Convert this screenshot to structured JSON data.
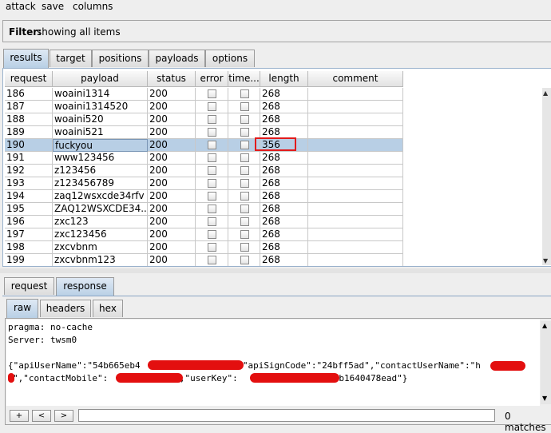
{
  "menu": [
    "attack",
    "save",
    "columns"
  ],
  "filter": {
    "label": "Filter:",
    "text": "showing all items"
  },
  "top_tabs": [
    "results",
    "target",
    "positions",
    "payloads",
    "options"
  ],
  "columns": [
    "request",
    "payload",
    "status",
    "error",
    "time...",
    "length",
    "comment"
  ],
  "rows": [
    {
      "request": "186",
      "payload": "woaini1314",
      "status": "200",
      "length": "268"
    },
    {
      "request": "187",
      "payload": "woaini1314520",
      "status": "200",
      "length": "268"
    },
    {
      "request": "188",
      "payload": "woaini520",
      "status": "200",
      "length": "268"
    },
    {
      "request": "189",
      "payload": "woaini521",
      "status": "200",
      "length": "268"
    },
    {
      "request": "190",
      "payload": "fuckyou",
      "status": "200",
      "length": "356"
    },
    {
      "request": "191",
      "payload": "www123456",
      "status": "200",
      "length": "268"
    },
    {
      "request": "192",
      "payload": "z123456",
      "status": "200",
      "length": "268"
    },
    {
      "request": "193",
      "payload": "z123456789",
      "status": "200",
      "length": "268"
    },
    {
      "request": "194",
      "payload": "zaq12wsxcde34rfv",
      "status": "200",
      "length": "268"
    },
    {
      "request": "195",
      "payload": "ZAQ12WSXCDE34...",
      "status": "200",
      "length": "268"
    },
    {
      "request": "196",
      "payload": "zxc123",
      "status": "200",
      "length": "268"
    },
    {
      "request": "197",
      "payload": "zxc123456",
      "status": "200",
      "length": "268"
    },
    {
      "request": "198",
      "payload": "zxcvbnm",
      "status": "200",
      "length": "268"
    },
    {
      "request": "199",
      "payload": "zxcvbnm123",
      "status": "200",
      "length": "268"
    }
  ],
  "selected_row": "190",
  "lower_tabs": [
    "request",
    "response"
  ],
  "view_tabs": [
    "raw",
    "headers",
    "hex"
  ],
  "response": {
    "line1": "pragma: no-cache",
    "line2": "Server: twsm0",
    "json_p1": "{\"apiUserName\":\"54b665eb4",
    "json_p2": "\",\"apiSignCode\":\"24bff5ad\",\"contactUserName\":\"h",
    "json_p3": "\",\"contactMobile\":",
    "json_p4": "\",\"userKey\":",
    "json_p5": "db1640478ead\"}"
  },
  "search": {
    "btn_plus": "+",
    "btn_prev": "<",
    "btn_next": ">",
    "value": "",
    "matches": "0 matches"
  },
  "colors": {
    "selection": "#b8cfe5",
    "highlight_box": "#e21b1b",
    "redaction": "#e30f0f"
  }
}
